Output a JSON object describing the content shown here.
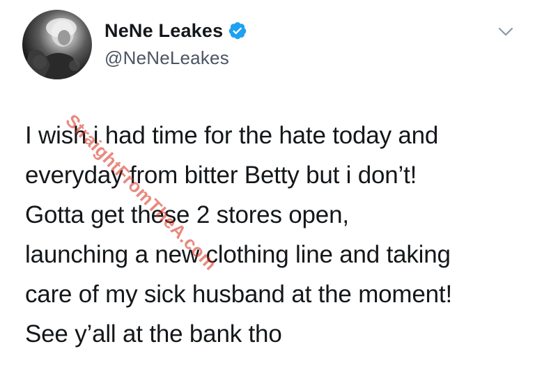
{
  "tweet": {
    "user": {
      "display_name": "NeNe Leakes",
      "handle": "@NeNeLeakes",
      "verified": true,
      "verified_icon": "verified-badge-icon",
      "verified_color": "#1da1f2"
    },
    "menu_icon": "chevron-down-icon",
    "text_lines": [
      "I wish i had time for the hate today and",
      "everyday from bitter Betty but i don’t!",
      "Gotta get these 2 stores open,",
      "launching a new clothing line and taking",
      "care of my sick husband at the moment!",
      "See y’all at the bank tho"
    ]
  },
  "watermark": {
    "text": "StraightFromTheA.com",
    "color": "#d72814"
  }
}
